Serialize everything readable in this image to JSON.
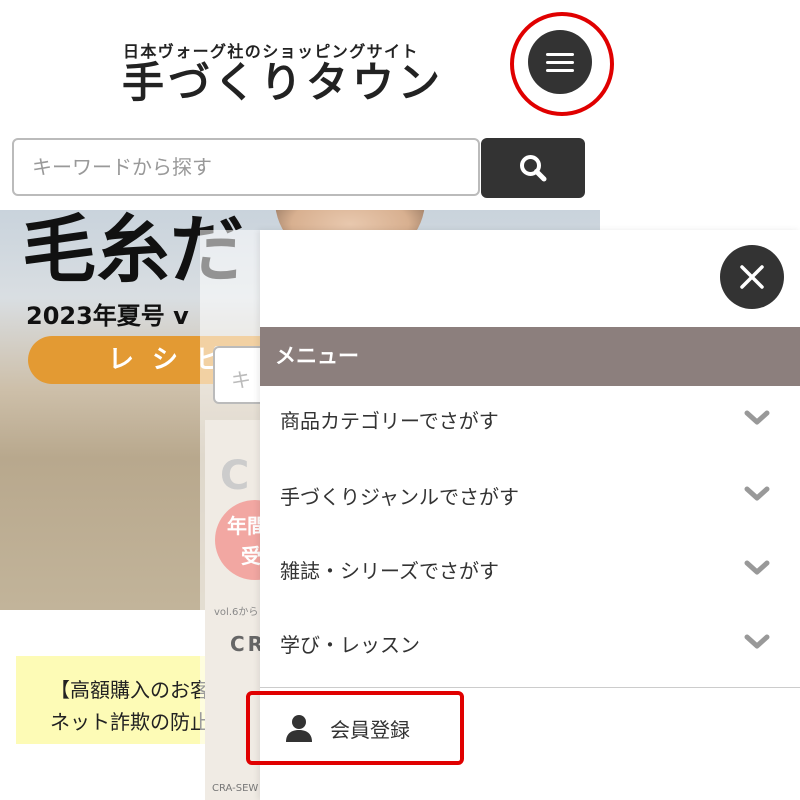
{
  "header": {
    "tagline": "日本ヴォーグ社のショッピングサイト",
    "site_name": "手づくりタウン"
  },
  "search": {
    "placeholder": "キーワードから探す"
  },
  "banner": {
    "title": "毛糸だ",
    "subtitle": "2023年夏号 v",
    "button_label": "レシピ"
  },
  "notice": {
    "line1": "【高額購入のお客",
    "line2": "ネット詐欺の防止"
  },
  "background_page": {
    "search_placeholder": "キ",
    "big_letter": "C",
    "badge_line1": "年間",
    "badge_line2": "受",
    "caption": "vol.6から",
    "brand": "CRA",
    "footer": "CRA-SEW"
  },
  "drawer": {
    "header": "メニュー",
    "items": [
      {
        "label": "商品カテゴリーでさがす",
        "icon": "chevron-down-icon"
      },
      {
        "label": "手づくりジャンルでさがす",
        "icon": "chevron-down-icon"
      },
      {
        "label": "雑誌・シリーズでさがす",
        "icon": "chevron-down-icon"
      },
      {
        "label": "学び・レッスン",
        "icon": "chevron-down-icon"
      }
    ],
    "register_label": "会員登録"
  },
  "colors": {
    "dark_button": "#333333",
    "drawer_header": "#8c7f7d",
    "highlight": "#e00000",
    "notice_bg": "#fdfbb6",
    "banner_pill": "#e39a33"
  }
}
